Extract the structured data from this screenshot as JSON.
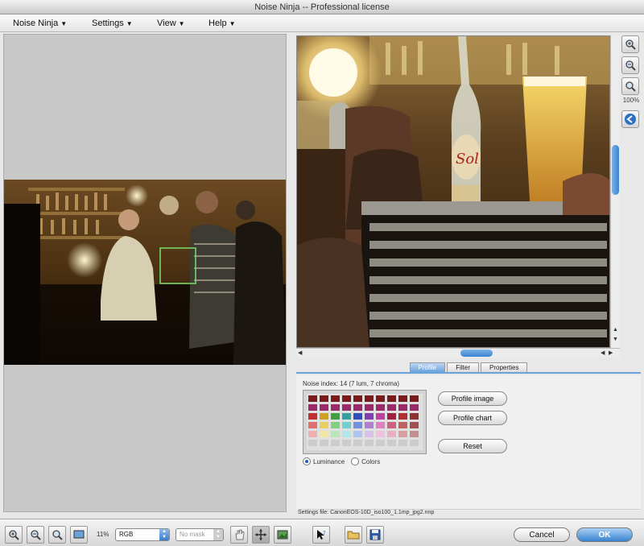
{
  "window": {
    "title": "Noise Ninja -- Professional license"
  },
  "menu": [
    {
      "label": "Noise Ninja"
    },
    {
      "label": "Settings"
    },
    {
      "label": "View"
    },
    {
      "label": "Help"
    }
  ],
  "tabs": [
    {
      "label": "Profile",
      "active": true
    },
    {
      "label": "Filter",
      "active": false
    },
    {
      "label": "Properties",
      "active": false
    }
  ],
  "profile": {
    "noise_index": "Noise index: 14 (7 lum, 7 chroma)",
    "profile_image_label": "Profile image",
    "profile_chart_label": "Profile chart",
    "reset_label": "Reset",
    "luminance_label": "Luminance",
    "colors_label": "Colors",
    "selected_mode": "Luminance"
  },
  "settings_file": "Settings file: CanonEOS-10D_iso100_1.1mp_jpg2.nnp",
  "zoom_panel": {
    "zoom_label": "100%"
  },
  "bottom": {
    "zoom_percent": "11%",
    "color_space": "RGB",
    "mode_select": "No mask",
    "cancel_label": "Cancel",
    "ok_label": "OK"
  },
  "colors": {
    "accent": "#3a84d0",
    "panel": "#c8c8c8",
    "tab_active": "#6aa3dc"
  }
}
